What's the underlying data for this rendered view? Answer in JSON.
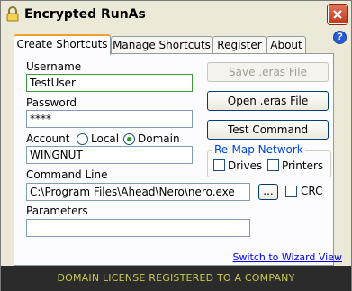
{
  "window": {
    "title": "Encrypted RunAs"
  },
  "tabs": [
    {
      "label": "Create Shortcuts",
      "active": true
    },
    {
      "label": "Manage Shortcuts",
      "active": false
    },
    {
      "label": "Register",
      "active": false
    },
    {
      "label": "About",
      "active": false
    }
  ],
  "form": {
    "username_label": "Username",
    "username_value": "TestUser",
    "password_label": "Password",
    "password_value": "****",
    "account_label": "Account",
    "account_options": [
      "Local",
      "Domain"
    ],
    "account_selected": "Domain",
    "account_value": "WINGNUT",
    "command_line_label": "Command Line",
    "command_line_value": "C:\\Program Files\\Ahead\\Nero\\nero.exe",
    "browse_label": "...",
    "crc_label": "CRC",
    "parameters_label": "Parameters",
    "parameters_value": ""
  },
  "actions": {
    "save_label": "Save .eras File",
    "open_label": "Open .eras File",
    "test_label": "Test Command"
  },
  "remap": {
    "title": "Re-Map Network",
    "drives_label": "Drives",
    "printers_label": "Printers"
  },
  "links": {
    "wizard": "Switch to Wizard View"
  },
  "footer": {
    "license_text": "DOMAIN LICENSE REGISTERED TO A COMPANY"
  },
  "colors": {
    "tab_accent": "#f0a030",
    "group_title": "#0046d5",
    "link": "#0000ee",
    "footer_bg": "#2b2b2b",
    "footer_text": "#c9c94a"
  },
  "icons": [
    "lock-icon",
    "close-icon",
    "help-icon"
  ]
}
